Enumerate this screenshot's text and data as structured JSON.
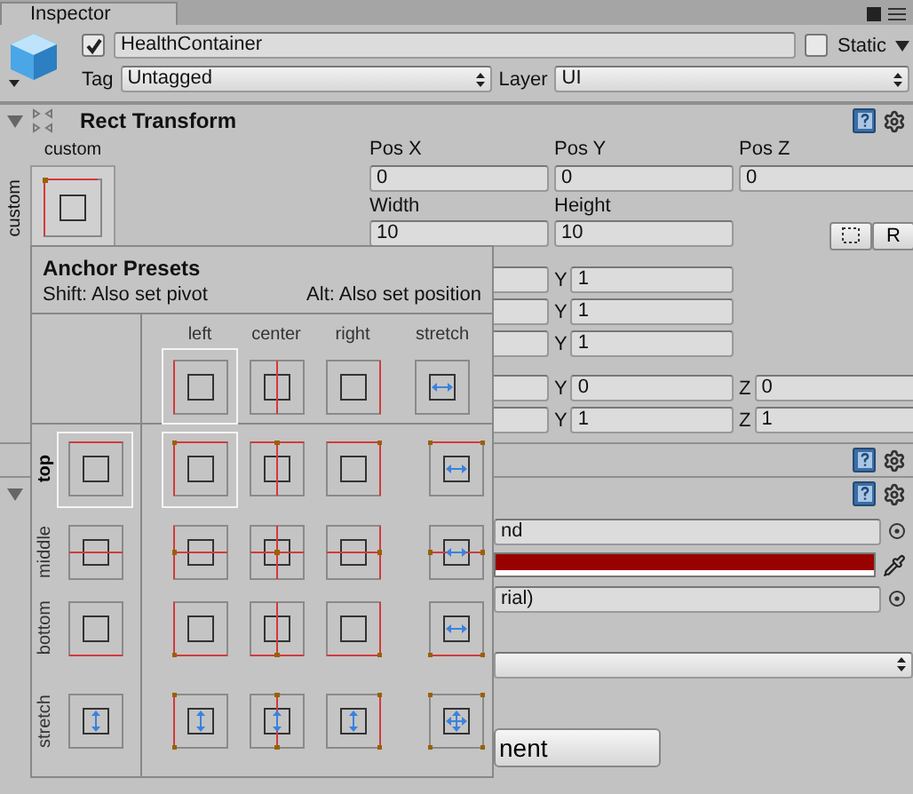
{
  "tab": {
    "title": "Inspector"
  },
  "object": {
    "active": true,
    "name": "HealthContainer",
    "static": false,
    "static_label": "Static",
    "tag_label": "Tag",
    "tag": "Untagged",
    "layer_label": "Layer",
    "layer": "UI"
  },
  "rect_transform": {
    "title": "Rect Transform",
    "expanded": true,
    "anchor_label": "custom",
    "anchor_side_label": "custom",
    "position": [
      {
        "label": "Pos X",
        "value": "0"
      },
      {
        "label": "Pos Y",
        "value": "0"
      },
      {
        "label": "Pos Z",
        "value": "0"
      }
    ],
    "size": [
      {
        "label": "Width",
        "value": "10"
      },
      {
        "label": "Height",
        "value": "10"
      }
    ],
    "raw_button": "R",
    "groups": [
      [
        [
          {
            "label": "Y",
            "value": "1"
          }
        ],
        [
          {
            "label": "Y",
            "value": "1"
          }
        ],
        [
          {
            "label": "Y",
            "value": "1"
          }
        ]
      ],
      [
        [
          {
            "label": "Y",
            "value": "0"
          },
          {
            "label": "Z",
            "value": "0"
          }
        ],
        [
          {
            "label": "Y",
            "value": "1"
          },
          {
            "label": "Z",
            "value": "1"
          }
        ]
      ]
    ]
  },
  "components": [
    {
      "expanded": true
    }
  ],
  "component_fields": [
    {
      "kind": "object",
      "value": "nd"
    },
    {
      "kind": "color",
      "color": "#990000"
    },
    {
      "kind": "object",
      "value": "rial)"
    },
    {
      "kind": "dropdown"
    }
  ],
  "add_button": "nent",
  "anchor_presets": {
    "title": "Anchor Presets",
    "shift_hint": "Shift: Also set pivot",
    "alt_hint": "Alt: Also set position",
    "columns": [
      {
        "label": "left",
        "kind": "left",
        "selected": true
      },
      {
        "label": "center",
        "kind": "center",
        "selected": false
      },
      {
        "label": "right",
        "kind": "right",
        "selected": false
      },
      {
        "label": "stretch",
        "kind": "stretch",
        "selected": false
      }
    ],
    "rows": [
      {
        "label": "top",
        "kind": "top",
        "selected": true
      },
      {
        "label": "middle",
        "kind": "middle",
        "selected": false
      },
      {
        "label": "bottom",
        "kind": "bottom",
        "selected": false
      },
      {
        "label": "stretch",
        "kind": "stretch",
        "selected": false
      }
    ]
  }
}
